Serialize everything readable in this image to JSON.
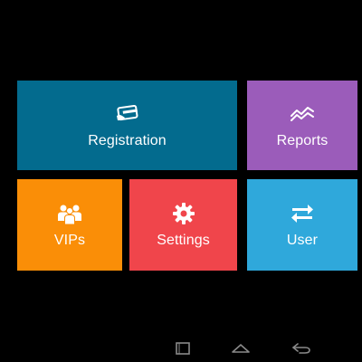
{
  "tiles": {
    "registration": {
      "label": "Registration",
      "color": "#036B8E",
      "icon": "card-swipe-icon"
    },
    "reports": {
      "label": "Reports",
      "color": "#9B5CBA",
      "icon": "trend-chart-icon"
    },
    "vips": {
      "label": "VIPs",
      "color": "#FA8E07",
      "icon": "people-group-icon"
    },
    "settings": {
      "label": "Settings",
      "color": "#F0454B",
      "icon": "gear-icon"
    },
    "user": {
      "label": "User",
      "color": "#2FA8DB",
      "icon": "swap-arrows-icon"
    }
  },
  "navigation_bar": {
    "buttons": [
      "recents-icon",
      "home-icon",
      "back-icon"
    ],
    "icon_color": "#8A8A8A"
  }
}
